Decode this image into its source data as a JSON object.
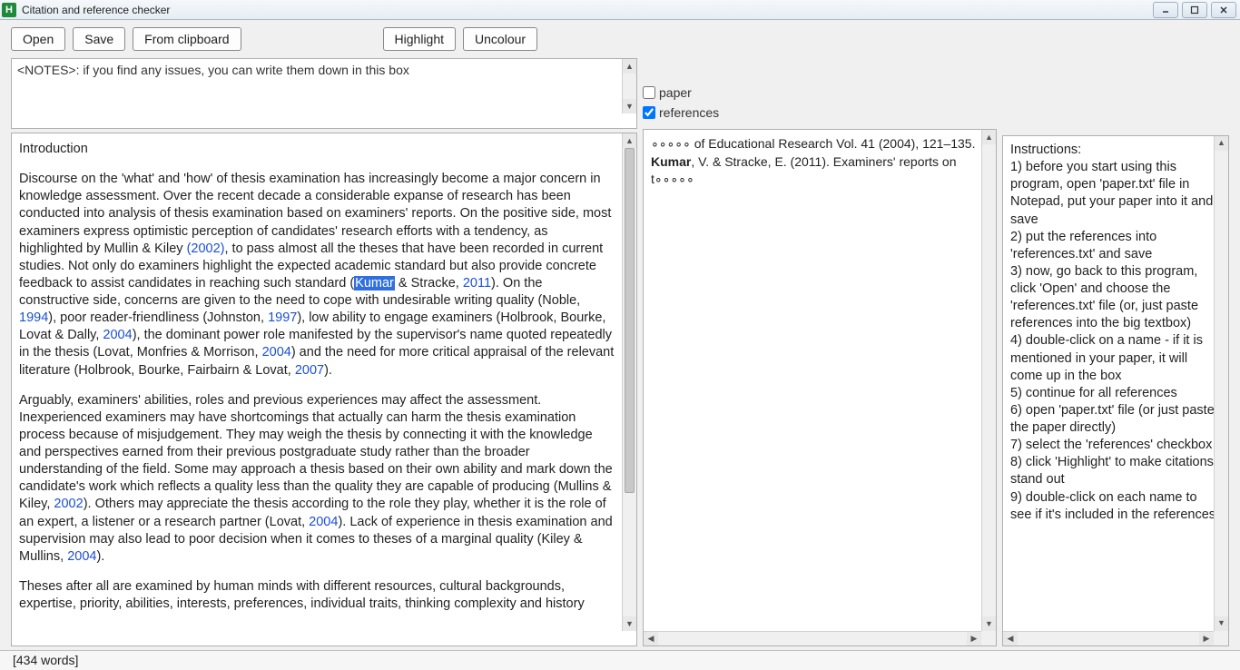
{
  "window": {
    "title": "Citation and reference checker",
    "app_icon_letter": "H"
  },
  "toolbar": {
    "open": "Open",
    "save": "Save",
    "from_clipboard": "From clipboard",
    "highlight": "Highlight",
    "uncolour": "Uncolour"
  },
  "notes": {
    "placeholder": "<NOTES>: if you find any issues, you can write them down in this box"
  },
  "checkboxes": {
    "paper_label": "paper",
    "paper_checked": false,
    "references_label": "references",
    "references_checked": true
  },
  "paper": {
    "heading": "Introduction",
    "p1_a": "Discourse on the 'what' and 'how' of thesis examination has increasingly become a major concern in knowledge assessment. Over the recent decade a considerable expanse of research has been conducted into analysis of thesis examination based on examiners' reports. On the positive side, most examiners express optimistic perception of candidates' research efforts with a tendency, as highlighted by Mullin & Kiley ",
    "c1": "(2002)",
    "p1_b": ", to pass almost all the theses that have been recorded in current studies. Not only do examiners highlight the expected academic standard but also provide concrete feedback to assist candidates in reaching such standard (",
    "hl": "Kumar",
    "p1_c": " & Stracke, ",
    "c2": "2011",
    "p1_d": "). On the constructive side, concerns are given to the need to cope with undesirable writing quality (Noble, ",
    "c3": "1994",
    "p1_e": "), poor reader-friendliness (Johnston, ",
    "c4": "1997",
    "p1_f": "), low ability to engage examiners (Holbrook, Bourke, Lovat & Dally, ",
    "c5": "2004",
    "p1_g": "), the dominant power role manifested by the supervisor's name quoted repeatedly in the thesis (Lovat, Monfries & Morrison, ",
    "c6": "2004",
    "p1_h": ") and the need for more critical appraisal of the relevant literature (Holbrook, Bourke, Fairbairn & Lovat, ",
    "c7": "2007",
    "p1_i": ").",
    "p2_a": "Arguably, examiners' abilities, roles and previous experiences may affect the assessment. Inexperienced examiners may have shortcomings that actually can harm the thesis examination process because of misjudgement. They may weigh the thesis by connecting it with the knowledge and perspectives earned from their previous postgraduate study rather than the broader understanding of the field. Some may approach a thesis based on their own ability and mark down the candidate's work which reflects a quality less than the quality they are capable of producing (Mullins & Kiley, ",
    "c8": "2002",
    "p2_b": "). Others may appreciate the thesis according to the role they play, whether it is the role of an expert, a listener or a research partner (Lovat, ",
    "c9": "2004",
    "p2_c": "). Lack of experience in thesis examination and supervision may also lead to poor decision when it comes to theses of a marginal quality (Kiley & Mullins, ",
    "c10": "2004",
    "p2_d": ").",
    "p3": "Theses after all are examined by human minds with different resources, cultural backgrounds, expertise, priority, abilities, interests, preferences, individual traits, thinking complexity and history"
  },
  "references": {
    "line1": "∘∘∘∘∘ of Educational Research Vol. 41 (2004), 121–135.",
    "line2a": "Kumar",
    "line2b": ", V. & Stracke, E. (2011). Examiners' reports on t∘∘∘∘∘"
  },
  "instructions": {
    "title": "Instructions:",
    "i1": "1) before you start using this program, open 'paper.txt' file in Notepad, put your paper into it and save",
    "i2": "2) put the references into 'references.txt' and save",
    "i3": "3) now, go back to this program, click 'Open' and choose the 'references.txt' file (or, just paste references into the big textbox)",
    "i4": "4) double-click on a name - if it is mentioned in your paper, it will come up in the box",
    "i5": "5) continue for all references",
    "i6": "6) open 'paper.txt' file (or just paste the paper directly)",
    "i7": "7) select the 'references' checkbox",
    "i8": "8) click 'Highlight' to make citations stand out",
    "i9": "9) double-click on each name to see if it's included in the references"
  },
  "status": {
    "text": "[434 words]"
  }
}
